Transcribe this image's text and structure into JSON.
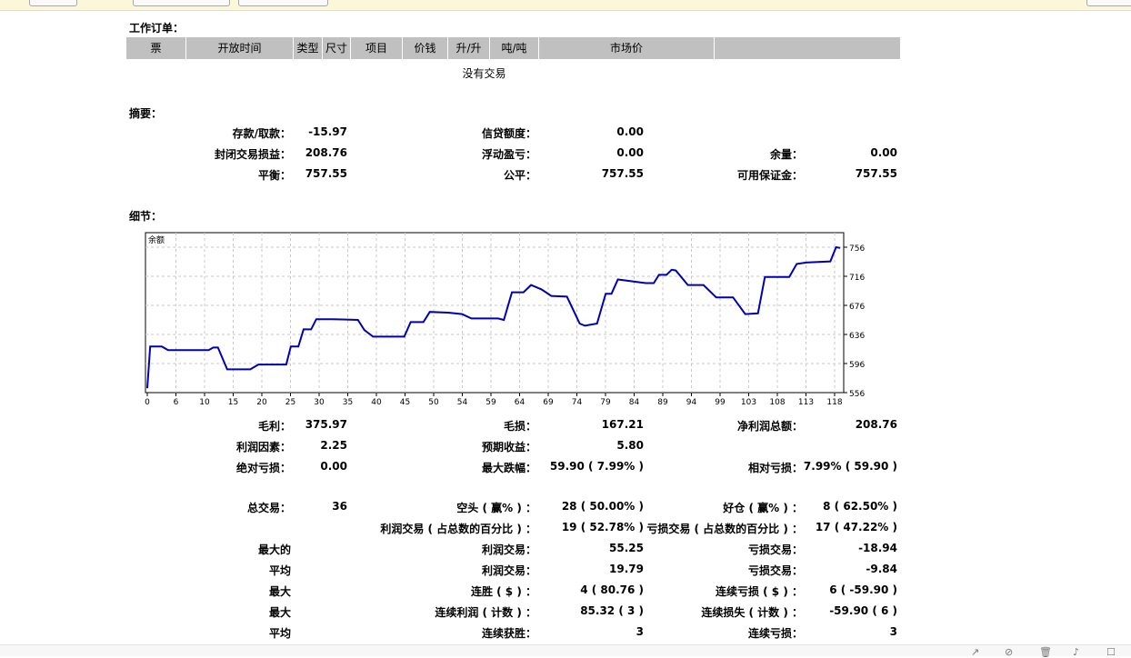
{
  "orders": {
    "title": "工作订单：",
    "columns": [
      "票",
      "开放时间",
      "类型",
      "尺寸",
      "项目",
      "价钱",
      "升/升",
      "吨/吨",
      "市场价",
      ""
    ],
    "empty_text": "没有交易"
  },
  "summary": {
    "title": "摘要：",
    "rows": [
      [
        "存款/取款：",
        "-15.97",
        "信贷额度：",
        "0.00",
        "",
        ""
      ],
      [
        "封闭交易损益：",
        "208.76",
        "浮动盈亏：",
        "0.00",
        "余量：",
        "0.00"
      ],
      [
        "平衡：",
        "757.55",
        "公平：",
        "757.55",
        "可用保证金：",
        "757.55"
      ]
    ]
  },
  "details": {
    "title": "细节：",
    "rows": [
      [
        "毛利：",
        "375.97",
        "毛损：",
        "167.21",
        "净利润总额：",
        "208.76"
      ],
      [
        "利润因素：",
        "2.25",
        "预期收益：",
        "5.80",
        "",
        ""
      ],
      [
        "绝对亏损：",
        "0.00",
        "最大跌幅：",
        "59.90 ( 7.99% )",
        "相对亏损：",
        "7.99% ( 59.90 )"
      ],
      [
        "总交易：",
        "36",
        "空头 ( 赢% ) ：",
        "28 ( 50.00% )",
        "好仓 ( 赢% ) ：",
        "8 ( 62.50% )"
      ],
      [
        "",
        "",
        "利润交易 ( 占总数的百分比 ) ：",
        "19 ( 52.78% )",
        "亏损交易 ( 占总数的百分比 ) ：",
        "17 ( 47.22% )"
      ],
      [
        "最大的",
        "",
        "利润交易：",
        "55.25",
        "亏损交易：",
        "-18.94"
      ],
      [
        "平均",
        "",
        "利润交易：",
        "19.79",
        "亏损交易：",
        "-9.84"
      ],
      [
        "最大",
        "",
        "连胜 ( $ ) ：",
        "4 ( 80.76 )",
        "连续亏损 ( $ ) ：",
        "6 ( -59.90 )"
      ],
      [
        "最大",
        "",
        "连续利润 ( 计数 ) ：",
        "85.32 ( 3 )",
        "连续损失 ( 计数 ) ：",
        "-59.90 ( 6 )"
      ],
      [
        "平均",
        "",
        "连续获胜：",
        "3",
        "连续亏损：",
        "3"
      ]
    ]
  },
  "chart_data": {
    "type": "line",
    "title": "余额",
    "series": [
      {
        "name": "余额",
        "color": "#0000b4",
        "x": [
          0,
          0.5,
          2.5,
          3.6,
          10.6,
          11.4,
          12.2,
          13.8,
          17.8,
          19.2,
          24,
          24.8,
          26.1,
          27,
          28.3,
          29.2,
          32,
          36.4,
          37.5,
          39,
          44.4,
          45.5,
          47.7,
          48.8,
          52,
          54.4,
          56,
          60.6,
          61.6,
          63,
          65,
          66.3,
          68.1,
          69.8,
          72.5,
          74.7,
          75.6,
          77.7,
          79.2,
          80.2,
          81.3,
          86.1,
          87.5,
          88.4,
          89.7,
          90.6,
          91.3,
          93.4,
          96.1,
          98.3,
          101.2,
          103.3,
          105.5,
          106.7,
          110.9,
          112.2,
          114,
          118,
          119,
          119.7
        ],
        "y": [
          562,
          619.5,
          619.5,
          614.5,
          614.5,
          618,
          618,
          588,
          588,
          594.6,
          594.6,
          619.5,
          619.5,
          643,
          643,
          657,
          657,
          656,
          642,
          633,
          633,
          653,
          653,
          667,
          666,
          664,
          658,
          658,
          656,
          694,
          694,
          704,
          698,
          689,
          688,
          651,
          648,
          651,
          692,
          692,
          711.6,
          706.6,
          706.6,
          718,
          718,
          725,
          724,
          704,
          704,
          687,
          687,
          664,
          665,
          715,
          715,
          733,
          735,
          736.5,
          756,
          755
        ]
      }
    ],
    "x_tick_labels": [
      "0",
      "6",
      "10",
      "15",
      "20",
      "25",
      "30",
      "35",
      "40",
      "45",
      "50",
      "54",
      "59",
      "64",
      "69",
      "74",
      "79",
      "84",
      "89",
      "94",
      "99",
      "103",
      "108",
      "113",
      "118"
    ],
    "y_tick_labels": [
      "556",
      "596",
      "636",
      "676",
      "716",
      "756"
    ],
    "ylim": [
      556,
      776
    ],
    "xlim": [
      0,
      120
    ],
    "grid": true,
    "legend": "top-left"
  }
}
